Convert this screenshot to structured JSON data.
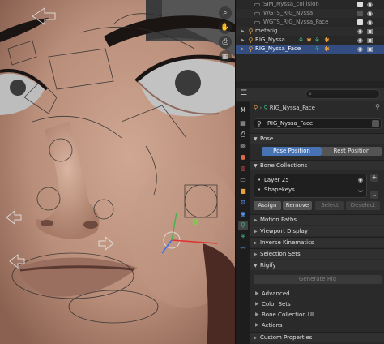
{
  "outliner": {
    "rows": [
      {
        "name": "SIM_Nyssa_collision",
        "style": "dim"
      },
      {
        "name": "WGTS_RIG_Nyssa",
        "style": "dim"
      },
      {
        "name": "WGTS_RIG_Nyssa_Face",
        "style": "dim"
      },
      {
        "name": "metarig",
        "style": "normal"
      },
      {
        "name": "RIG_Nyssa",
        "style": "normal"
      },
      {
        "name": "RIG_Nyssa_Face",
        "style": "selected"
      }
    ]
  },
  "properties": {
    "search_placeholder": "",
    "breadcrumb": "RIG_Nyssa_Face",
    "armature_name": "RIG_Nyssa_Face",
    "pose": {
      "title": "Pose",
      "pose_position_label": "Pose Position",
      "rest_position_label": "Rest Position"
    },
    "bone_collections": {
      "title": "Bone Collections",
      "items": [
        "Layer 25",
        "Shapekeys"
      ],
      "assign_label": "Assign",
      "remove_label": "Remove",
      "select_label": "Select",
      "deselect_label": "Deselect"
    },
    "panels": {
      "motion_paths": "Motion Paths",
      "viewport_display": "Viewport Display",
      "inverse_kinematics": "Inverse Kinematics",
      "selection_sets": "Selection Sets",
      "rigify": "Rigify",
      "custom_properties": "Custom Properties"
    },
    "rigify": {
      "generate_label": "Generate Rig",
      "subpanels": [
        "Advanced",
        "Color Sets",
        "Bone Collection UI",
        "Actions"
      ]
    }
  },
  "colors": {
    "accent": "#4772b3",
    "selected_row": "#334d80",
    "armature_orange": "#e8a040",
    "bone_green": "#3fbf8a"
  },
  "icons": {
    "viewport_tools": [
      "zoom-icon",
      "hand-pan-icon",
      "camera-icon",
      "grid-icon"
    ]
  }
}
